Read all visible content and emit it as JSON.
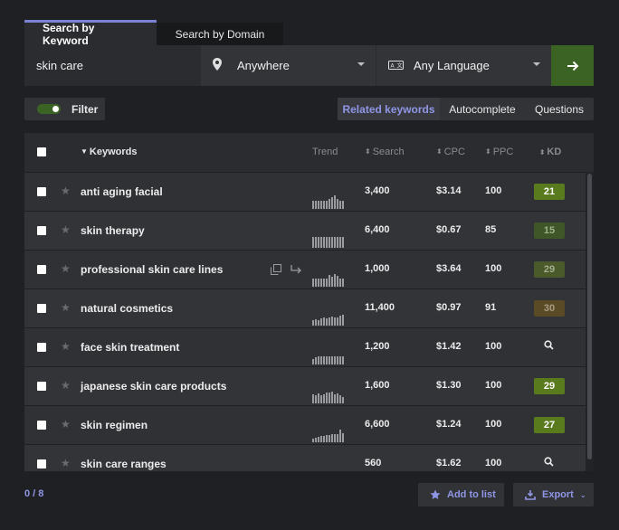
{
  "tabs": [
    {
      "label": "Search by Keyword",
      "active": true
    },
    {
      "label": "Search by Domain",
      "active": false
    }
  ],
  "search": {
    "keyword_value": "skin care",
    "location": "Anywhere",
    "language": "Any Language"
  },
  "toolbar": {
    "filter_label": "Filter",
    "filter_on": true,
    "modes": [
      "Related keywords",
      "Autocomplete",
      "Questions"
    ],
    "active_mode": "Related keywords"
  },
  "table": {
    "headers": {
      "keywords": "Keywords",
      "trend": "Trend",
      "search": "Search",
      "cpc": "CPC",
      "ppc": "PPC",
      "kd": "KD"
    },
    "rows": [
      {
        "keyword": "anti aging facial",
        "search": "3,400",
        "cpc": "$3.14",
        "ppc": "100",
        "kd": "21",
        "kd_color": "#5a7a1e",
        "kd_text": "#ffffff",
        "trend": [
          9,
          9,
          9,
          9,
          9,
          9,
          11,
          13,
          15,
          11,
          9,
          9
        ]
      },
      {
        "keyword": "skin therapy",
        "search": "6,400",
        "cpc": "$0.67",
        "ppc": "85",
        "kd": "15",
        "kd_color": "#3f5628",
        "kd_text": "#9fb08a",
        "trend": [
          12,
          12,
          12,
          12,
          12,
          12,
          12,
          12,
          12,
          12,
          12,
          12
        ]
      },
      {
        "keyword": "professional skin care lines",
        "search": "1,000",
        "cpc": "$3.64",
        "ppc": "100",
        "kd": "29",
        "kd_color": "#4b5a2a",
        "kd_text": "#a3ad8e",
        "trend": [
          9,
          9,
          9,
          9,
          9,
          9,
          13,
          11,
          14,
          12,
          9,
          9
        ]
      },
      {
        "keyword": "natural cosmetics",
        "search": "11,400",
        "cpc": "$0.97",
        "ppc": "91",
        "kd": "30",
        "kd_color": "#5a4a26",
        "kd_text": "#a89a82",
        "trend": [
          6,
          7,
          6,
          8,
          9,
          8,
          9,
          10,
          9,
          9,
          11,
          12
        ]
      },
      {
        "keyword": "face skin treatment",
        "search": "1,200",
        "cpc": "$1.42",
        "ppc": "100",
        "kd": "",
        "kd_color": "",
        "kd_text": "",
        "trend": [
          6,
          8,
          9,
          9,
          9,
          9,
          9,
          9,
          9,
          9,
          9,
          9
        ]
      },
      {
        "keyword": "japanese skin care products",
        "search": "1,600",
        "cpc": "$1.30",
        "ppc": "100",
        "kd": "29",
        "kd_color": "#5a7a1e",
        "kd_text": "#ffffff",
        "trend": [
          10,
          9,
          11,
          9,
          10,
          12,
          12,
          13,
          10,
          11,
          9,
          7
        ]
      },
      {
        "keyword": "skin regimen",
        "search": "6,600",
        "cpc": "$1.24",
        "ppc": "100",
        "kd": "27",
        "kd_color": "#5a7a1e",
        "kd_text": "#ffffff",
        "trend": [
          4,
          5,
          6,
          7,
          7,
          8,
          8,
          9,
          9,
          9,
          14,
          10
        ]
      },
      {
        "keyword": "skin care ranges",
        "search": "560",
        "cpc": "$1.62",
        "ppc": "100",
        "kd": "",
        "kd_color": "",
        "kd_text": "",
        "trend": [
          0,
          0,
          0,
          0,
          0,
          0,
          0,
          0,
          0,
          0,
          3,
          0
        ]
      }
    ]
  },
  "footer": {
    "selected_count": "0 / 8",
    "add_label": "Add to list",
    "export_label": "Export"
  },
  "colors": {
    "accent": "#8f96e6",
    "go_button": "#3b6324"
  }
}
